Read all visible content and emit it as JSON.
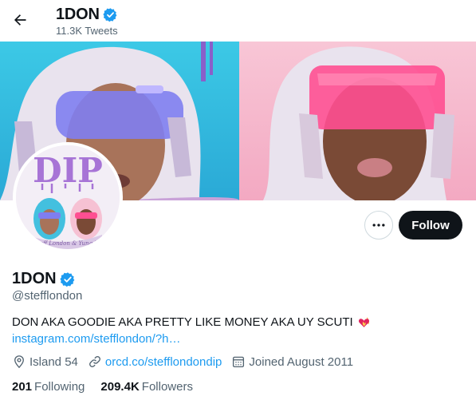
{
  "header": {
    "title": "1DON",
    "tweet_count": "11.3K Tweets"
  },
  "profile": {
    "display_name": "1DON",
    "handle": "@stefflondon",
    "bio": "DON AKA GOODIE AKA PRETTY LIKE MONEY AKA UY SCUTI",
    "bio_emoji": "❤️‍🔥",
    "bio_link": "instagram.com/stefflondon/?h…",
    "avatar_text": "DIP",
    "avatar_caption": "Steff London & Yung Bo"
  },
  "actions": {
    "more_label": "More",
    "follow_label": "Follow"
  },
  "meta": {
    "location": "Island 54",
    "website": "orcd.co/stefflondondip",
    "joined": "Joined August 2011"
  },
  "stats": {
    "following_count": "201",
    "following_label": "Following",
    "followers_count": "209.4K",
    "followers_label": "Followers"
  },
  "colors": {
    "accent": "#1d9bf0",
    "text": "#0f1419",
    "secondary": "#536471",
    "follow_bg": "#0f1419"
  },
  "icons": [
    "back-arrow-icon",
    "verified-badge-icon",
    "more-dots-icon",
    "location-pin-icon",
    "link-icon",
    "calendar-icon"
  ]
}
